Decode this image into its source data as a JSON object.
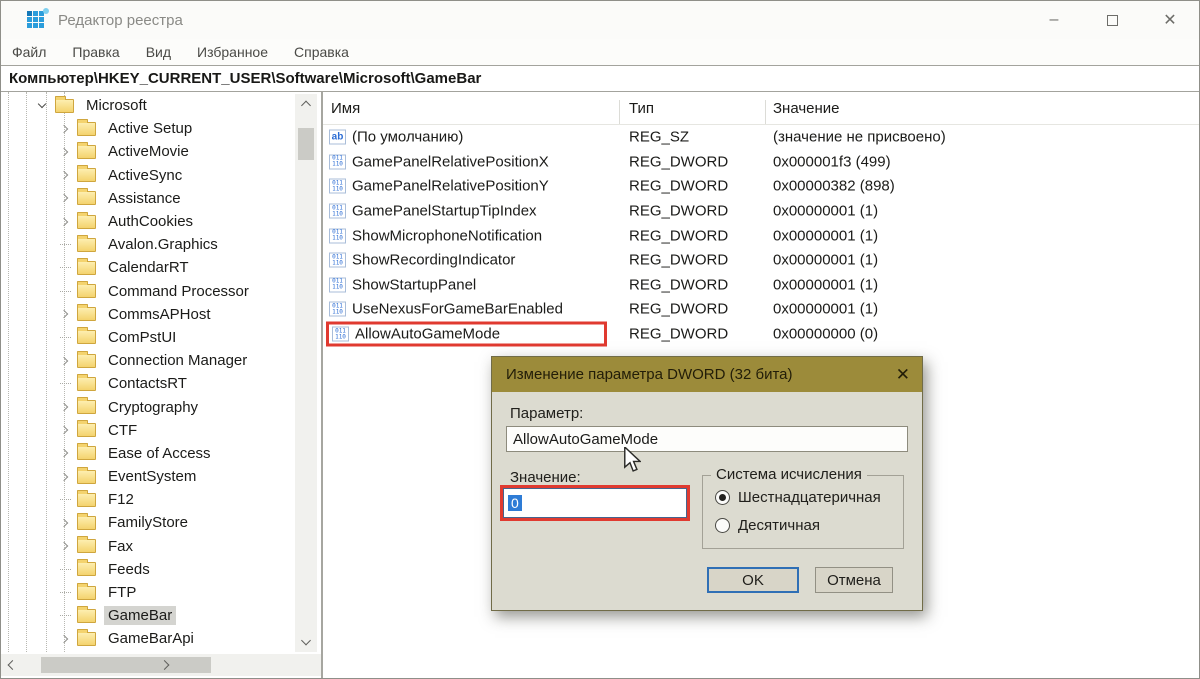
{
  "window": {
    "title": "Редактор реестра",
    "controls": {
      "minimize": "–",
      "close": "✕"
    }
  },
  "menu": {
    "items": [
      "Файл",
      "Правка",
      "Вид",
      "Избранное",
      "Справка"
    ]
  },
  "address_bar": {
    "value": "Компьютер\\HKEY_CURRENT_USER\\Software\\Microsoft\\GameBar"
  },
  "tree": {
    "parent": {
      "label": "Microsoft",
      "expanded": true
    },
    "items": [
      {
        "label": "Active Setup",
        "chevron": true
      },
      {
        "label": "ActiveMovie",
        "chevron": true
      },
      {
        "label": "ActiveSync",
        "chevron": true
      },
      {
        "label": "Assistance",
        "chevron": true
      },
      {
        "label": "AuthCookies",
        "chevron": true
      },
      {
        "label": "Avalon.Graphics",
        "chevron": false
      },
      {
        "label": "CalendarRT",
        "chevron": false
      },
      {
        "label": "Command Processor",
        "chevron": false
      },
      {
        "label": "CommsAPHost",
        "chevron": true
      },
      {
        "label": "ComPstUI",
        "chevron": false
      },
      {
        "label": "Connection Manager",
        "chevron": true
      },
      {
        "label": "ContactsRT",
        "chevron": false
      },
      {
        "label": "Cryptography",
        "chevron": true
      },
      {
        "label": "CTF",
        "chevron": true
      },
      {
        "label": "Ease of Access",
        "chevron": true
      },
      {
        "label": "EventSystem",
        "chevron": true
      },
      {
        "label": "F12",
        "chevron": false
      },
      {
        "label": "FamilyStore",
        "chevron": true
      },
      {
        "label": "Fax",
        "chevron": true
      },
      {
        "label": "Feeds",
        "chevron": false
      },
      {
        "label": "FTP",
        "chevron": false
      },
      {
        "label": "GameBar",
        "chevron": false,
        "selected": true
      },
      {
        "label": "GameBarApi",
        "chevron": true
      }
    ]
  },
  "list": {
    "columns": [
      "Имя",
      "Тип",
      "Значение"
    ],
    "rows": [
      {
        "icon": "string-value-icon",
        "name": "(По умолчанию)",
        "type": "REG_SZ",
        "value": "(значение не присвоено)"
      },
      {
        "icon": "dword-value-icon",
        "name": "GamePanelRelativePositionX",
        "type": "REG_DWORD",
        "value": "0x000001f3 (499)"
      },
      {
        "icon": "dword-value-icon",
        "name": "GamePanelRelativePositionY",
        "type": "REG_DWORD",
        "value": "0x00000382 (898)"
      },
      {
        "icon": "dword-value-icon",
        "name": "GamePanelStartupTipIndex",
        "type": "REG_DWORD",
        "value": "0x00000001 (1)"
      },
      {
        "icon": "dword-value-icon",
        "name": "ShowMicrophoneNotification",
        "type": "REG_DWORD",
        "value": "0x00000001 (1)"
      },
      {
        "icon": "dword-value-icon",
        "name": "ShowRecordingIndicator",
        "type": "REG_DWORD",
        "value": "0x00000001 (1)"
      },
      {
        "icon": "dword-value-icon",
        "name": "ShowStartupPanel",
        "type": "REG_DWORD",
        "value": "0x00000001 (1)"
      },
      {
        "icon": "dword-value-icon",
        "name": "UseNexusForGameBarEnabled",
        "type": "REG_DWORD",
        "value": "0x00000001 (1)"
      },
      {
        "icon": "dword-value-icon",
        "name": "AllowAutoGameMode",
        "type": "REG_DWORD",
        "value": "0x00000000 (0)",
        "highlighted": true
      }
    ]
  },
  "dialog": {
    "title": "Изменение параметра DWORD (32 бита)",
    "close": "✕",
    "param_label": "Параметр:",
    "param_value": "AllowAutoGameMode",
    "value_label": "Значение:",
    "value_value": "0",
    "radix_group_label": "Система исчисления",
    "radio_hex": "Шестнадцатеричная",
    "radio_dec": "Десятичная",
    "hex_selected": true,
    "ok_label": "OK",
    "cancel_label": "Отмена"
  },
  "colors": {
    "highlight_red": "#e03a30",
    "dialog_titlebar": "#9c8b3a",
    "dialog_body": "#dcdbd0",
    "focus_blue": "#2f6fb5",
    "folder_yellow": "#f4d36e"
  }
}
